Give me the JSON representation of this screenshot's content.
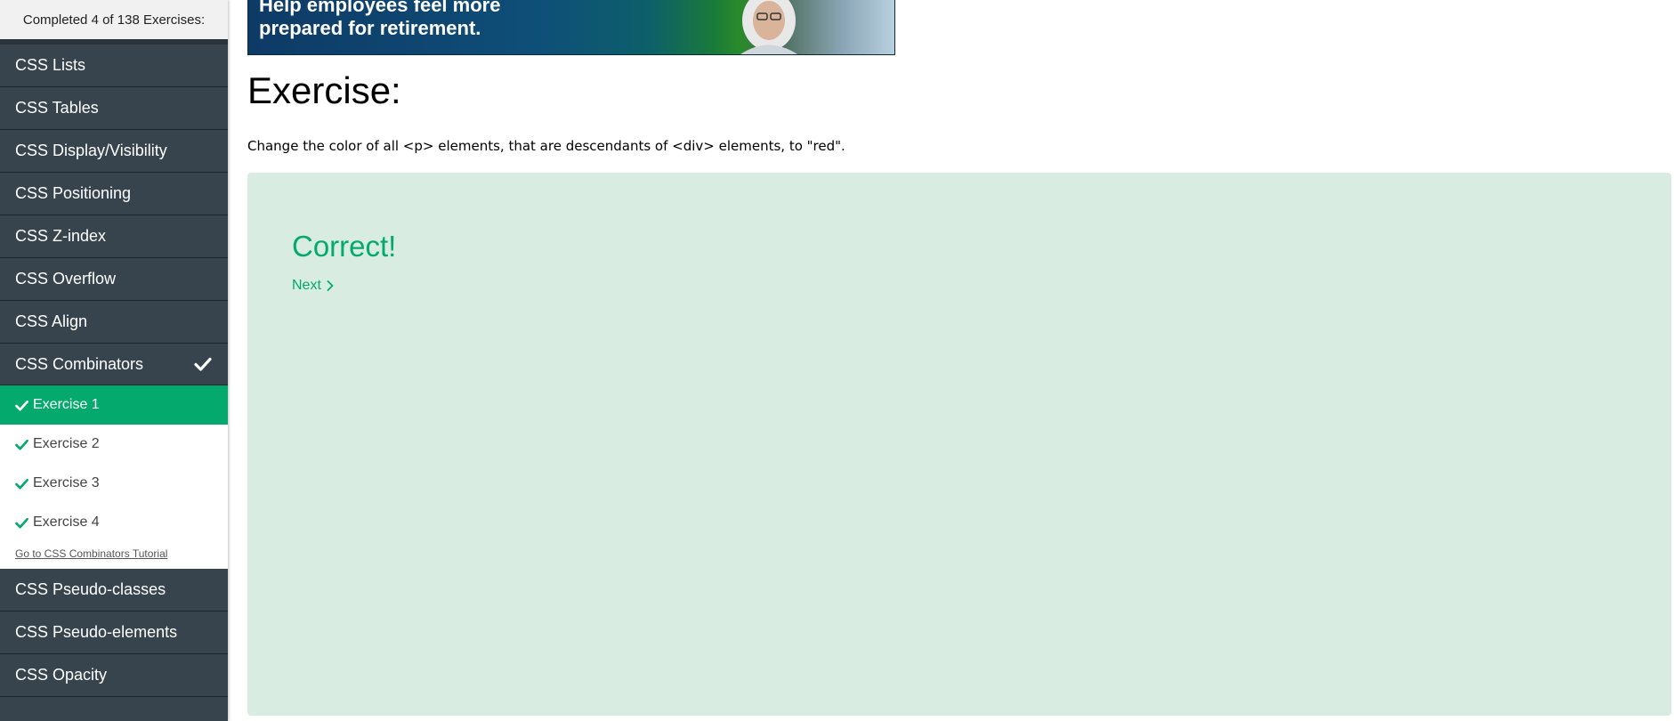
{
  "sidebar": {
    "progress_text": "Completed 4 of 138 Exercises:",
    "topics_before": [
      {
        "label": "CSS Lists"
      },
      {
        "label": "CSS Tables"
      },
      {
        "label": "CSS Display/Visibility"
      },
      {
        "label": "CSS Positioning"
      },
      {
        "label": "CSS Z-index"
      },
      {
        "label": "CSS Overflow"
      },
      {
        "label": "CSS Align"
      }
    ],
    "active_topic": {
      "label": "CSS Combinators",
      "completed": true
    },
    "exercises": [
      {
        "label": "Exercise 1",
        "completed": true,
        "current": true
      },
      {
        "label": "Exercise 2",
        "completed": true,
        "current": false
      },
      {
        "label": "Exercise 3",
        "completed": true,
        "current": false
      },
      {
        "label": "Exercise 4",
        "completed": true,
        "current": false
      }
    ],
    "tutorial_link": "Go to CSS Combinators Tutorial",
    "topics_after": [
      {
        "label": "CSS Pseudo-classes"
      },
      {
        "label": "CSS Pseudo-elements"
      },
      {
        "label": "CSS Opacity"
      }
    ]
  },
  "ad": {
    "text_line1": "Help employees feel more",
    "text_line2": "prepared for retirement."
  },
  "main": {
    "title": "Exercise:",
    "instruction": "Change the color of all <p> elements, that are descendants of <div> elements, to \"red\".",
    "result": {
      "title": "Correct!",
      "next_label": "Next"
    }
  },
  "colors": {
    "sidebar_bg": "#38444d",
    "accent_green": "#04aa6d",
    "result_bg": "#d9ece2"
  }
}
